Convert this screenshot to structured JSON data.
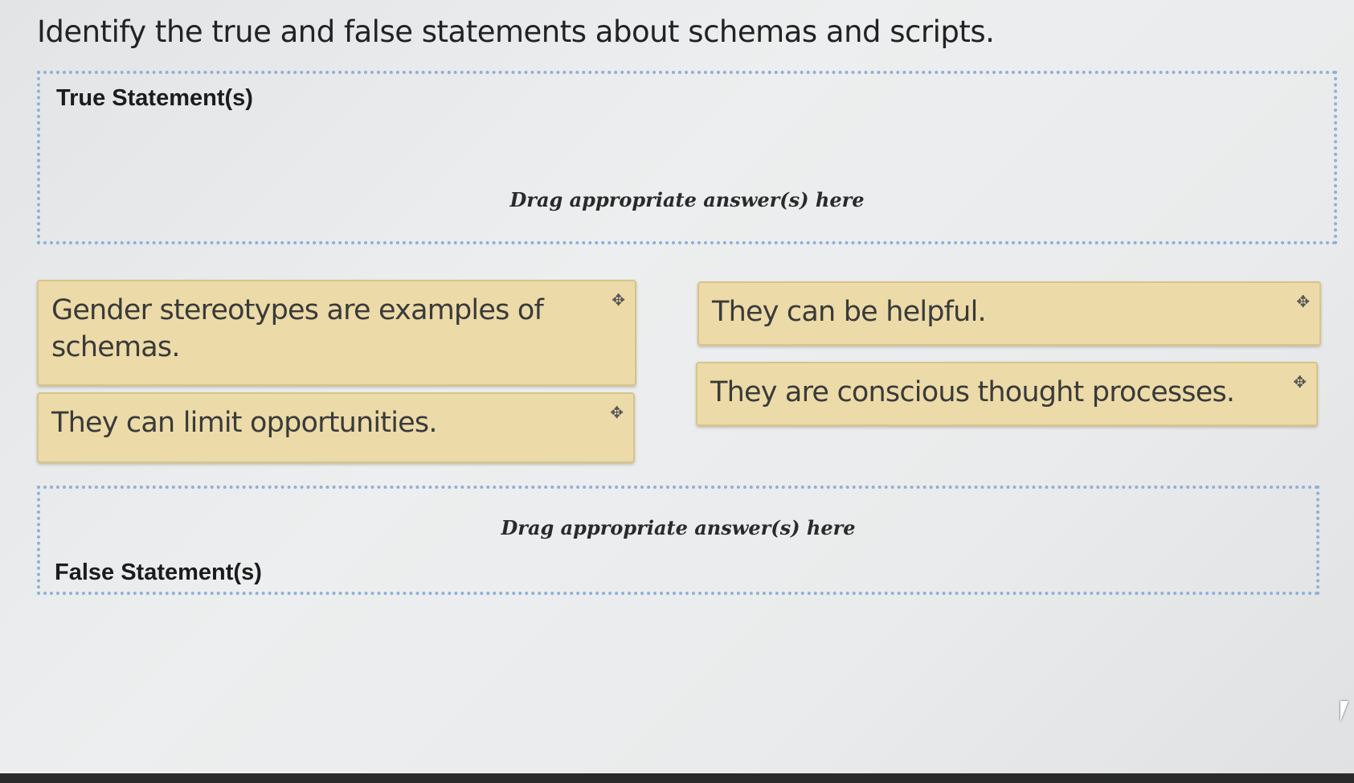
{
  "question": {
    "text": "Identify the true and false statements about schemas and scripts."
  },
  "zones": {
    "true_zone": {
      "heading": "True Statement(s)",
      "hint": "Drag appropriate answer(s) here"
    },
    "false_zone": {
      "heading": "False Statement(s)",
      "hint": "Drag appropriate answer(s) here"
    }
  },
  "tiles": [
    {
      "text": "Gender stereotypes are examples of schemas.",
      "icon": "move-icon"
    },
    {
      "text": "They can limit opportunities.",
      "icon": "move-icon"
    },
    {
      "text": "They can be helpful.",
      "icon": "move-icon"
    },
    {
      "text": "They are conscious thought processes.",
      "icon": "move-icon"
    }
  ],
  "icons": {
    "move_glyph": "✥"
  },
  "colors": {
    "tile_background": "#ecdba8",
    "dropzone_border": "#8fb0d6"
  }
}
